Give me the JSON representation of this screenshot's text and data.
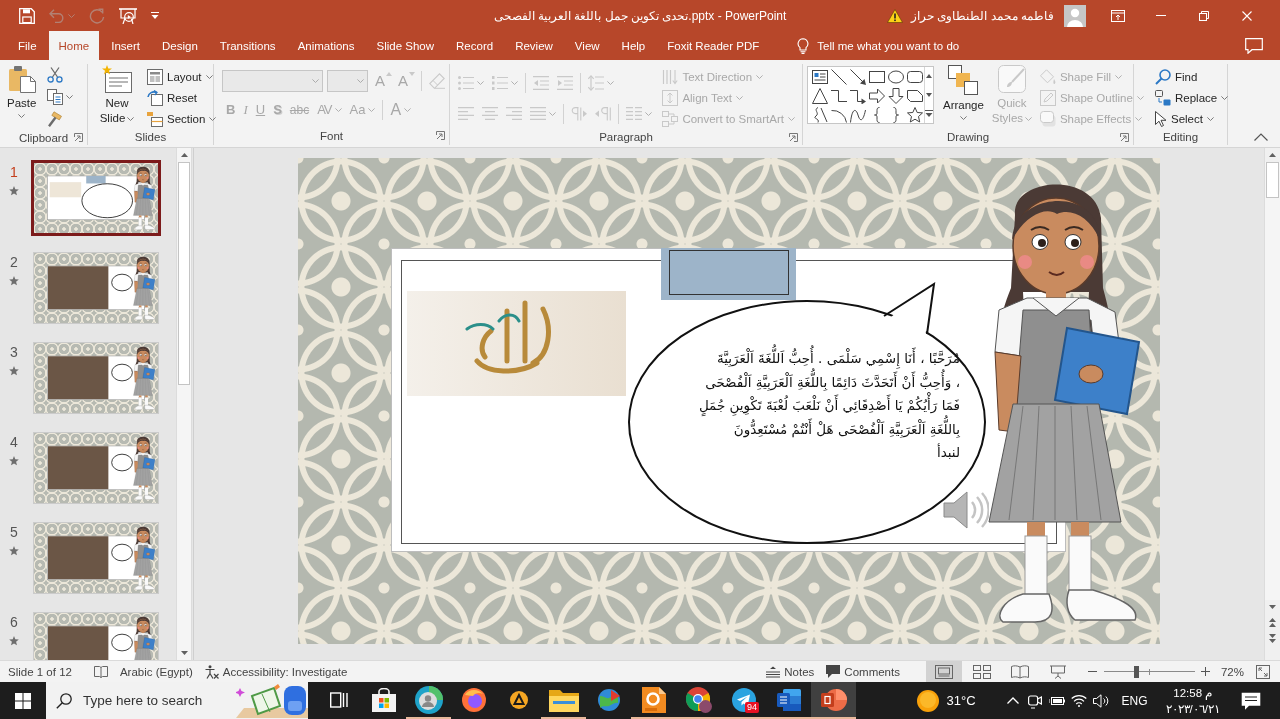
{
  "title_bar": {
    "quick_access": [
      {
        "kind": "save",
        "disabled": false,
        "dropdown": false
      },
      {
        "kind": "undo",
        "disabled": true,
        "dropdown": true
      },
      {
        "kind": "redo",
        "disabled": true,
        "dropdown": false
      },
      {
        "kind": "present",
        "disabled": false,
        "dropdown": false
      },
      {
        "kind": "customize",
        "disabled": false,
        "dropdown": false
      }
    ],
    "title": "تحدى تكوين جمل باللغة العربية الفصحى.pptx  -  PowerPoint",
    "user": "فاطمه محمد الطنطاوى حراز"
  },
  "ribbon_tabs": [
    {
      "label": "File",
      "selected": false
    },
    {
      "label": "Home",
      "selected": true
    },
    {
      "label": "Insert",
      "selected": false
    },
    {
      "label": "Design",
      "selected": false
    },
    {
      "label": "Transitions",
      "selected": false
    },
    {
      "label": "Animations",
      "selected": false
    },
    {
      "label": "Slide Show",
      "selected": false
    },
    {
      "label": "Record",
      "selected": false
    },
    {
      "label": "Review",
      "selected": false
    },
    {
      "label": "View",
      "selected": false
    },
    {
      "label": "Help",
      "selected": false
    },
    {
      "label": "Foxit Reader PDF",
      "selected": false
    }
  ],
  "tell_me": {
    "placeholder": "Tell me what you want to do"
  },
  "ribbon": [
    {
      "kind": "clipboard",
      "label": "Clipboard",
      "launcher": true,
      "paste": {
        "label": "Paste",
        "disabled": false
      },
      "tools": [
        {
          "kind": "cut",
          "dropdown": false,
          "disabled": false
        },
        {
          "kind": "copy",
          "dropdown": true,
          "disabled": false
        },
        {
          "kind": "format-painter",
          "dropdown": false,
          "disabled": false
        }
      ]
    },
    {
      "kind": "slides",
      "label": "Slides",
      "launcher": false,
      "new_slide": {
        "label": "New Slide",
        "disabled": false
      },
      "commands": [
        {
          "kind": "layout",
          "label": "Layout",
          "dropdown": true,
          "disabled": false
        },
        {
          "kind": "reset",
          "label": "Reset",
          "dropdown": false,
          "disabled": false
        },
        {
          "kind": "section",
          "label": "Section",
          "dropdown": true,
          "disabled": false
        }
      ]
    },
    {
      "kind": "font",
      "label": "Font",
      "launcher": true,
      "font_name": {
        "disabled": true
      },
      "font_size": {
        "disabled": true
      },
      "size_tools": [
        {
          "kind": "grow",
          "glyph": "A",
          "disabled": true
        },
        {
          "kind": "shrink",
          "glyph": "A",
          "disabled": true
        },
        {
          "kind": "clear",
          "disabled": true
        }
      ],
      "format": [
        {
          "kind": "bold",
          "glyph": "B",
          "dropdown": false,
          "disabled": true
        },
        {
          "kind": "italic",
          "glyph": "I",
          "dropdown": false,
          "disabled": true
        },
        {
          "kind": "underline",
          "glyph": "U",
          "dropdown": false,
          "disabled": true
        },
        {
          "kind": "shadow",
          "glyph": "S",
          "dropdown": false,
          "disabled": true
        },
        {
          "kind": "strike",
          "glyph": "abc",
          "dropdown": false,
          "disabled": true
        },
        {
          "kind": "spacing",
          "glyph": "AV",
          "dropdown": true,
          "disabled": true
        },
        {
          "kind": "case",
          "glyph": "Aa",
          "dropdown": true,
          "disabled": true
        },
        {
          "kind": "color",
          "glyph": "A",
          "dropdown": true,
          "disabled": true
        }
      ]
    },
    {
      "kind": "paragraph",
      "label": "Paragraph",
      "launcher": true,
      "rows": [
        [
          {
            "kind": "bullets",
            "dropdown": true,
            "disabled": true
          },
          {
            "kind": "numbering",
            "dropdown": true,
            "disabled": true
          },
          {
            "kind": "decrease-indent",
            "dropdown": false,
            "disabled": true
          },
          {
            "kind": "increase-indent",
            "dropdown": false,
            "disabled": true
          },
          {
            "kind": "line-spacing",
            "dropdown": true,
            "disabled": true
          }
        ],
        [
          {
            "kind": "align-left",
            "dropdown": false,
            "disabled": true
          },
          {
            "kind": "align-center",
            "dropdown": false,
            "disabled": true
          },
          {
            "kind": "align-right",
            "dropdown": false,
            "disabled": true
          },
          {
            "kind": "justify",
            "dropdown": true,
            "disabled": true
          },
          {
            "kind": "left-to-right",
            "dropdown": false,
            "disabled": true
          },
          {
            "kind": "right-to-left",
            "dropdown": false,
            "disabled": true
          },
          {
            "kind": "columns",
            "dropdown": true,
            "disabled": true
          }
        ]
      ],
      "commands": [
        {
          "kind": "text-direction",
          "label": "Text Direction",
          "dropdown": true,
          "disabled": true
        },
        {
          "kind": "align-text",
          "label": "Align Text",
          "dropdown": true,
          "disabled": true
        },
        {
          "kind": "convert-to-smartart",
          "label": "Convert to SmartArt",
          "dropdown": true,
          "disabled": true
        }
      ]
    },
    {
      "kind": "drawing",
      "label": "Drawing",
      "launcher": true,
      "arrange": {
        "label": "Arrange",
        "disabled": false
      },
      "quick_styles": {
        "label": "Quick Styles",
        "disabled": true
      },
      "commands": [
        {
          "kind": "shape-fill",
          "label": "Shape Fill",
          "dropdown": true,
          "disabled": true
        },
        {
          "kind": "shape-outline",
          "label": "Shape Outline",
          "dropdown": true,
          "disabled": true
        },
        {
          "kind": "shape-effects",
          "label": "Shape Effects",
          "dropdown": true,
          "disabled": true
        }
      ]
    },
    {
      "kind": "editing",
      "label": "Editing",
      "launcher": false,
      "commands": [
        {
          "kind": "find",
          "label": "Find",
          "dropdown": false,
          "disabled": false
        },
        {
          "kind": "replace",
          "label": "Replace",
          "dropdown": true,
          "disabled": false
        },
        {
          "kind": "select",
          "label": "Select",
          "dropdown": true,
          "disabled": false
        }
      ]
    }
  ],
  "slides_pane": {
    "thumbnails": [
      {
        "number": "1",
        "kind": "title",
        "selected": true,
        "animated": true
      },
      {
        "number": "2",
        "kind": "photo",
        "selected": false,
        "animated": true
      },
      {
        "number": "3",
        "kind": "photo",
        "selected": false,
        "animated": true
      },
      {
        "number": "4",
        "kind": "photo",
        "selected": false,
        "animated": true
      },
      {
        "number": "5",
        "kind": "photo",
        "selected": false,
        "animated": true
      },
      {
        "number": "6",
        "kind": "photo",
        "selected": false,
        "animated": true
      }
    ]
  },
  "slide": {
    "speech_lines": [
      "مُرَحَّبًا ، أَنَا إِسْمِي سَلْمَى . أُحِبُّ اَللُّغَةَ اَلْعَرَبِيَّةَ",
      "، وَأُحِبُّ أَنْ أَتَحَدَّثَ دَائِمًا بِاللُّغَةِ اَلْعَرَبِيَّةِ اَلْفُصْحَى",
      "فَمَا رَأْيُكُمْ يَا أَصْدِقَائِي أَنْ نَلْعَبَ لُعْبَةَ تَكْوِينِ جُمَلٍ",
      "بِاللُّغَةِ اَلْعَرَبِيَّةِ اَلْفُصْحَى هَلْ أَنْتُمْ مُسْتَعِدُّونَ",
      "لنبدأ"
    ]
  },
  "status_bar": {
    "slide_info": "Slide 1 of 12",
    "language": "Arabic (Egypt)",
    "accessibility": "Accessibility: Investigate",
    "notes": "Notes",
    "comments": "Comments",
    "views": [
      {
        "kind": "normal",
        "selected": true
      },
      {
        "kind": "sorter",
        "selected": false
      },
      {
        "kind": "reading",
        "selected": false
      },
      {
        "kind": "slideshow",
        "selected": false
      }
    ],
    "zoom": {
      "level": 0.35,
      "reading": "72%"
    }
  },
  "taskbar": {
    "search": {
      "placeholder": "Type here to search"
    },
    "apps": [
      {
        "kind": "task-view",
        "running": false,
        "selected": false
      },
      {
        "kind": "store",
        "running": false,
        "selected": false
      },
      {
        "kind": "edge",
        "running": true,
        "selected": false
      },
      {
        "kind": "firefox",
        "running": false,
        "selected": false
      },
      {
        "kind": "aimp",
        "running": false,
        "selected": false
      },
      {
        "kind": "explorer",
        "running": true,
        "selected": false
      },
      {
        "kind": "globe",
        "running": false,
        "selected": false
      },
      {
        "kind": "foxit",
        "running": true,
        "selected": false
      },
      {
        "kind": "chrome",
        "running": true,
        "selected": false
      },
      {
        "kind": "telegram",
        "running": true,
        "selected": false,
        "badge": "94"
      },
      {
        "kind": "word",
        "running": true,
        "selected": false
      },
      {
        "kind": "powerpoint",
        "running": true,
        "selected": true
      }
    ],
    "weather": "31°C",
    "language": "ENG",
    "time": "12:58 م",
    "date": "٢٠٢٣/٠٦/٢١"
  }
}
